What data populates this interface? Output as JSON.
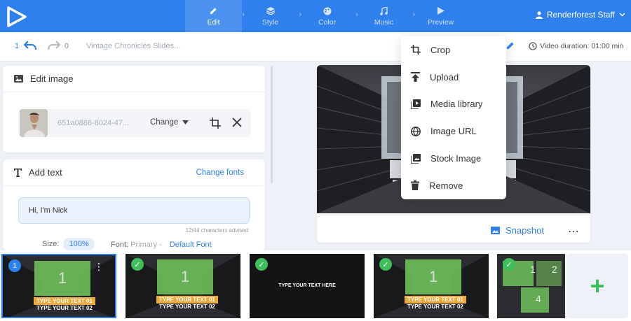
{
  "nav": {
    "steps": [
      {
        "label": "Edit",
        "icon": "pencil-icon",
        "active": true
      },
      {
        "label": "Style",
        "icon": "layers-icon",
        "active": false
      },
      {
        "label": "Color",
        "icon": "palette-icon",
        "active": false
      },
      {
        "label": "Music",
        "icon": "music-note-icon",
        "active": false
      },
      {
        "label": "Preview",
        "icon": "play-icon",
        "active": false
      }
    ],
    "user_name": "Renderforest Staff"
  },
  "toolbar": {
    "undo_count": "1",
    "redo_count": "0",
    "project_title": "Vintage Chronicles Slides...",
    "duration": "Video duration: 01:00 min"
  },
  "edit_image": {
    "title": "Edit image",
    "file_name": "651a0886-8024-47...",
    "change_label": "Change"
  },
  "add_text": {
    "title": "Add text",
    "change_fonts": "Change fonts",
    "input_value": "Hi, I'm Nick",
    "char_advice": "12/44 characters advised",
    "size_label": "Size:",
    "size_value": "100%",
    "font_label": "Font:",
    "font_current": "Primary -",
    "font_default": "Default Font"
  },
  "preview": {
    "snapshot_label": "Snapshot"
  },
  "dropdown": {
    "items": [
      {
        "label": "Crop",
        "icon": "crop-icon"
      },
      {
        "label": "Upload",
        "icon": "upload-icon"
      },
      {
        "label": "Media library",
        "icon": "media-library-icon"
      },
      {
        "label": "Image URL",
        "icon": "globe-icon"
      },
      {
        "label": "Stock Image",
        "icon": "stock-image-icon"
      },
      {
        "label": "Remove",
        "icon": "trash-icon"
      }
    ]
  },
  "timeline": {
    "slides": [
      {
        "badge": "1",
        "box_text": "1",
        "line1": "TYPE YOUR TEXT 01",
        "line2": "TYPE YOUR TEXT 02"
      },
      {
        "box_text": "1",
        "line1": "TYPE YOUR TEXT 01",
        "line2": "TYPE YOUR TEXT 02"
      },
      {
        "center": "TYPE YOUR TEXT HERE"
      },
      {
        "box_text": "1",
        "line1": "TYPE YOUR TEXT 01",
        "line2": "TYPE YOUR TEXT 02"
      },
      {
        "grid": [
          "1",
          "2",
          "4"
        ]
      }
    ],
    "add_label": "+"
  },
  "colors": {
    "brand": "#2f80ed",
    "success": "#3fbf5c",
    "accent_orange": "#f2a93b"
  }
}
